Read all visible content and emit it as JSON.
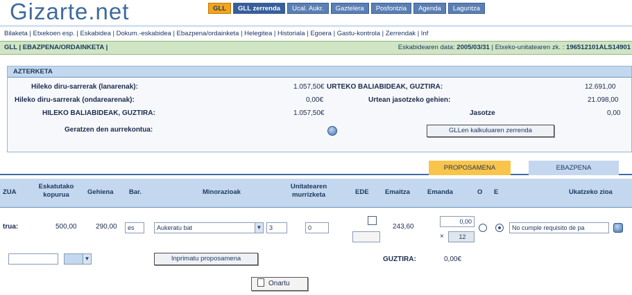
{
  "app": {
    "logo": "Gizarte.net"
  },
  "tabs": [
    {
      "label": "GLL"
    },
    {
      "label": "GLL zerrenda"
    },
    {
      "label": "Ucal. Aukr."
    },
    {
      "label": "Gaztelera"
    },
    {
      "label": "Posfontzia"
    },
    {
      "label": "Agenda"
    },
    {
      "label": "Laguntza"
    }
  ],
  "navlinks": "Bilaketa | Etxekoen esp. | Eskabidea | Dokum.-eskabidea | Ebazpena/ordainketa | Helegitea | Historiala | Egoera | Gastu-kontrola | Zerrendak | Inf",
  "status": {
    "left": "GLL | EBAZPENA/ORDAINKETA |",
    "right_prefix": "Eskabidearen data:",
    "date": "2005/03/31",
    "right_mid": "| Etxeko-unitatearen zk. :",
    "code": "196512101ALS14901"
  },
  "panel1": {
    "header": "AZTERKETA",
    "rows": [
      {
        "label": "Hileko diru-sarrerak (lanarenak):",
        "value": "1.057,50€",
        "label2": "URTEKO BALIABIDEAK, GUZTIRA:",
        "value2": "12.691,00"
      },
      {
        "label": "Hileko diru-sarrerak (ondarearenak):",
        "value": "0,00€",
        "label2": "Urtean jasotzeko gehien:",
        "value2": "21.098,00"
      },
      {
        "label": "HILEKO BALIABIDEAK, GUZTIRA:",
        "value": "1.057,50€",
        "label2": "Jasotze",
        "value2": "0,00"
      }
    ],
    "aurrekontua_label": "Geratzen den aurrekontua:",
    "kalkulua_button": "GLLen kalkuluaren zerrenda"
  },
  "subtabs": {
    "proposamena": "PROPOSAMENA",
    "ebazpena": "EBAZPENA"
  },
  "table": {
    "headers": {
      "h0": "ZUA",
      "h1": "Eskatutako kopurua",
      "h2": "Gehiena",
      "h3": "Bar.",
      "h4": "Minorazioak",
      "h5": "Unitatearen murrizketa",
      "h6": "EDE",
      "h7": "Emaitza",
      "h8": "Emanda",
      "h9": "O",
      "h10": "E",
      "h11": "Ukatzeko zioa"
    },
    "row": {
      "label": "trua:",
      "eskatutako": "500,00",
      "gehiena": "290,00",
      "bar": "es",
      "minorazioak": "Aukeratu bat",
      "minor_num": "3",
      "murrizketa": "0",
      "emaitza": "243,60",
      "emanda_top": "0,00",
      "emanda_bottom": "12",
      "ukatzeko": "No cumple requisito de pa"
    },
    "guztira_label": "GUZTIRA:",
    "guztira_value": "0,00€",
    "inprimatu_button": "Inprimatu proposamena"
  },
  "footer": {
    "onartu": "Onartu"
  },
  "colors": {
    "accent": "#f2a41c",
    "header_blue": "#c3d7ee",
    "status_green": "#cfe5c4"
  }
}
